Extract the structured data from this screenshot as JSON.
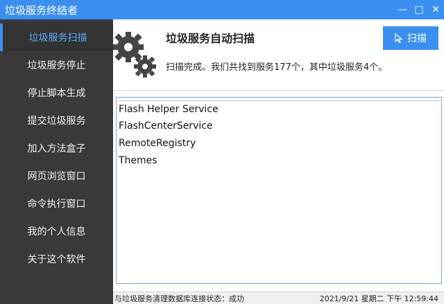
{
  "window": {
    "title": "垃圾服务终结者",
    "minimize_icon": "minimize-icon",
    "maximize_icon": "maximize-icon",
    "close_icon": "close-icon",
    "accent": "#3b8ff0"
  },
  "sidebar": {
    "items": [
      {
        "label": "垃圾服务扫描",
        "active": true
      },
      {
        "label": "垃圾服务停止"
      },
      {
        "label": "停止脚本生成"
      },
      {
        "label": "提交垃圾服务"
      },
      {
        "label": "加入方法盒子"
      },
      {
        "label": "网页浏览窗口"
      },
      {
        "label": "命令执行窗口"
      },
      {
        "label": "我的个人信息"
      },
      {
        "label": "关于这个软件"
      }
    ]
  },
  "main": {
    "title": "垃圾服务自动扫描",
    "status": "扫描完成。我们共找到服务177个，其中垃圾服务4个。",
    "scan_button": "扫描",
    "results": [
      "Flash Helper Service",
      "FlashCenterService",
      "RemoteRegistry",
      "Themes"
    ]
  },
  "statusbar": {
    "left": "与垃圾服务清理数据库连接状态：成功",
    "right": "2021/9/21 星期二 下午 12:59:44"
  }
}
